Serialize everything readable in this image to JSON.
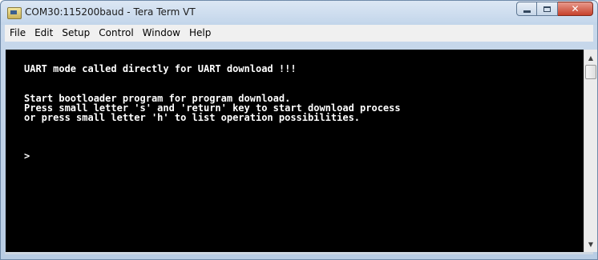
{
  "window": {
    "title": "COM30:115200baud - Tera Term VT",
    "caption_buttons": {
      "minimize_icon": "minimize-icon",
      "maximize_icon": "maximize-icon",
      "close_icon": "close-icon",
      "close_glyph": "✕"
    }
  },
  "menu": {
    "items": [
      "File",
      "Edit",
      "Setup",
      "Control",
      "Window",
      "Help"
    ]
  },
  "terminal": {
    "lines": [
      "UART mode called directly for UART download !!!",
      "Start bootloader program for program download.",
      "Press small letter 's' and 'return' key to start download process",
      "or press small letter 'h' to list operation possibilities.",
      ">"
    ],
    "foreground": "#ffffff",
    "background": "#000000"
  },
  "scrollbar": {
    "up_arrow": "▲",
    "down_arrow": "▼"
  }
}
